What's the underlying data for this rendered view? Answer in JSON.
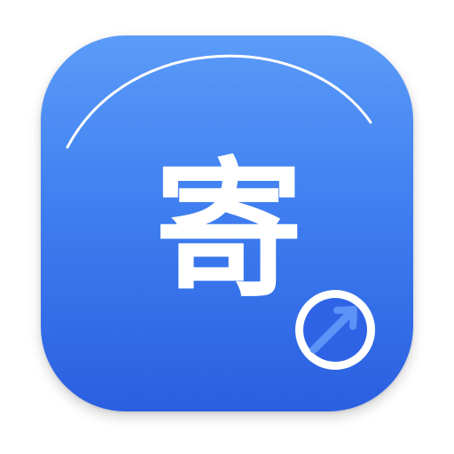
{
  "app_icon": {
    "glyph": "寄",
    "badge_icon": "arrow-up-right-circle-icon",
    "colors": {
      "gradient_top": "#5b9bf8",
      "gradient_bottom": "#2a5fe0",
      "glyph": "#ffffff",
      "badge_arrow": "#4a86f2"
    }
  }
}
